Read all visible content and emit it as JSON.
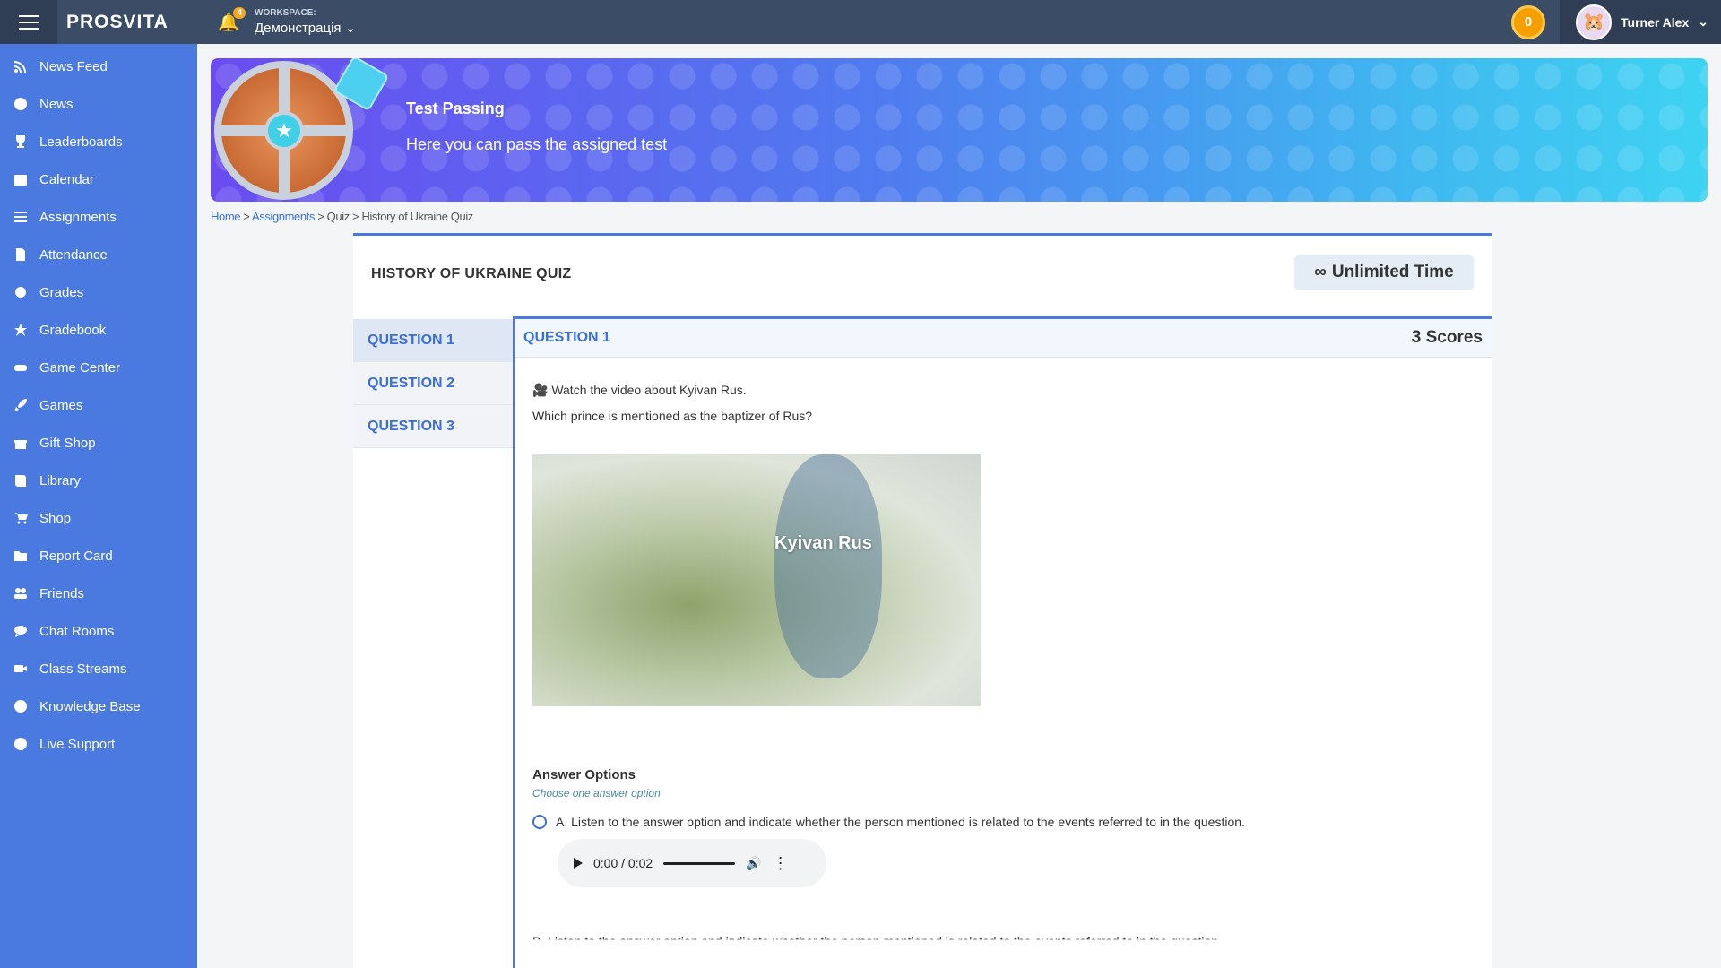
{
  "topbar": {
    "logo": "PROSVITA",
    "notification_count": "4",
    "workspace_label": "WORKSPACE:",
    "workspace_value": "Демонстрація",
    "coins": "0",
    "user_name": "Turner Alex"
  },
  "sidebar": {
    "items": [
      {
        "label": "News Feed",
        "icon": "rss-icon"
      },
      {
        "label": "News",
        "icon": "info-icon"
      },
      {
        "label": "Leaderboards",
        "icon": "trophy-icon"
      },
      {
        "label": "Calendar",
        "icon": "calendar-icon"
      },
      {
        "label": "Assignments",
        "icon": "list-icon"
      },
      {
        "label": "Attendance",
        "icon": "file-icon"
      },
      {
        "label": "Grades",
        "icon": "badge-icon"
      },
      {
        "label": "Gradebook",
        "icon": "star-icon"
      },
      {
        "label": "Game Center",
        "icon": "gamepad-icon"
      },
      {
        "label": "Games",
        "icon": "rocket-icon"
      },
      {
        "label": "Gift Shop",
        "icon": "gift-icon"
      },
      {
        "label": "Library",
        "icon": "book-icon"
      },
      {
        "label": "Shop",
        "icon": "cart-icon"
      },
      {
        "label": "Report Card",
        "icon": "folder-icon"
      },
      {
        "label": "Friends",
        "icon": "users-icon"
      },
      {
        "label": "Chat Rooms",
        "icon": "chat-icon"
      },
      {
        "label": "Class Streams",
        "icon": "video-icon"
      },
      {
        "label": "Knowledge Base",
        "icon": "info-icon"
      },
      {
        "label": "Live Support",
        "icon": "question-icon"
      }
    ]
  },
  "banner": {
    "title": "Test Passing",
    "subtitle": "Here you can pass the assigned test"
  },
  "breadcrumb": {
    "home": "Home",
    "sep": ">",
    "assignments": "Assignments",
    "quiz": "Quiz",
    "current": "History of Ukraine Quiz"
  },
  "quiz": {
    "title": "HISTORY OF UKRAINE QUIZ",
    "time_label": "Unlimited Time",
    "questions": [
      "QUESTION 1",
      "QUESTION 2",
      "QUESTION 3"
    ],
    "current_header": "QUESTION 1",
    "scores": "3 Scores",
    "line1": "🎥 Watch the video about Kyivan Rus.",
    "line2": "Which prince is mentioned as the baptizer of Rus?",
    "video_label": "Kyivan Rus",
    "answer_title": "Answer Options",
    "answer_sub": "Choose one answer option",
    "option_a": "A.  Listen to the answer option and indicate whether the person mentioned is related to the events referred to in the question.",
    "option_b": "B.  Listen to the answer option and indicate whether the person mentioned is related to the events referred to in the question.",
    "audio_time": "0:00 / 0:02"
  }
}
